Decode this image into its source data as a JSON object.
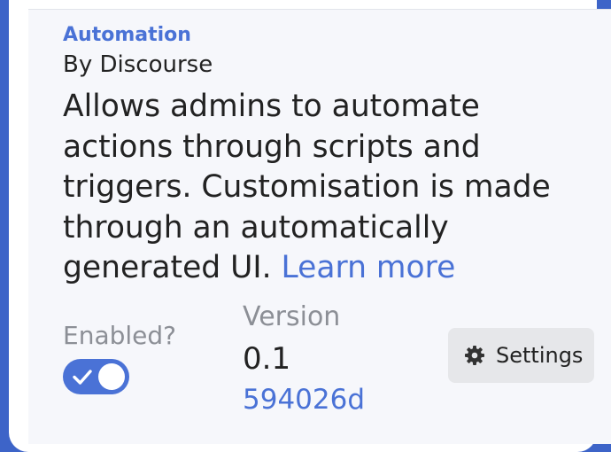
{
  "plugin": {
    "name": "Automation",
    "author": "By Discourse",
    "description": "Allows admins to automate actions through scripts and triggers. Customisation is made through an automatically generated UI.",
    "learn_more": "Learn more"
  },
  "enabled": {
    "label": "Enabled?",
    "value": true
  },
  "version": {
    "label": "Version",
    "number": "0.1",
    "commit": "594026d"
  },
  "settings": {
    "label": "Settings",
    "icon": "gear-icon"
  },
  "colors": {
    "accent": "#4a72d6",
    "page_background": "#3d64c8",
    "panel_background": "#f6f7fb",
    "muted_text": "#8c8f96",
    "button_background": "#e6e7ea"
  }
}
